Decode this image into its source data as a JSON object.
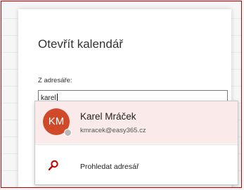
{
  "dialog": {
    "title": "Otevřít kalendář",
    "field_label": "Z adresáře:",
    "input_value": "karel"
  },
  "suggestion": {
    "initials": "KM",
    "name": "Karel Mráček",
    "email": "kmracek@easy365.cz",
    "avatar_color": "#d04a2a",
    "highlight_color": "#fbeaea"
  },
  "search_directory": {
    "label": "Prohledat adresář",
    "icon": "search-icon",
    "icon_color": "#c00000"
  }
}
